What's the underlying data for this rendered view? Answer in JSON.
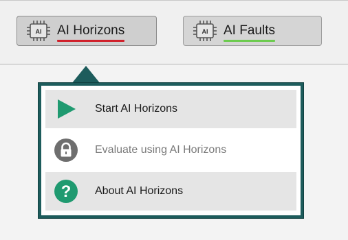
{
  "toolbar": {
    "buttons": [
      {
        "label": "AI Horizons",
        "icon": "ai-chip-icon",
        "chip_text": "AI",
        "underline_color": "#d0202a",
        "active": true
      },
      {
        "label": "AI Faults",
        "icon": "ai-chip-icon",
        "chip_text": "AI",
        "underline_color": "#6ccb4e",
        "active": false
      }
    ]
  },
  "popup_menu": {
    "accent_color": "#1d5c5c",
    "items": [
      {
        "label": "Start AI Horizons",
        "icon": "play-icon",
        "enabled": true
      },
      {
        "label": "Evaluate using AI Horizons",
        "icon": "lock-icon",
        "enabled": false
      },
      {
        "label": "About AI Horizons",
        "icon": "help-icon",
        "enabled": true
      }
    ]
  },
  "colors": {
    "play_icon": "#1f9a70",
    "help_icon": "#1f9a70",
    "lock_icon": "#6e6e6e"
  }
}
